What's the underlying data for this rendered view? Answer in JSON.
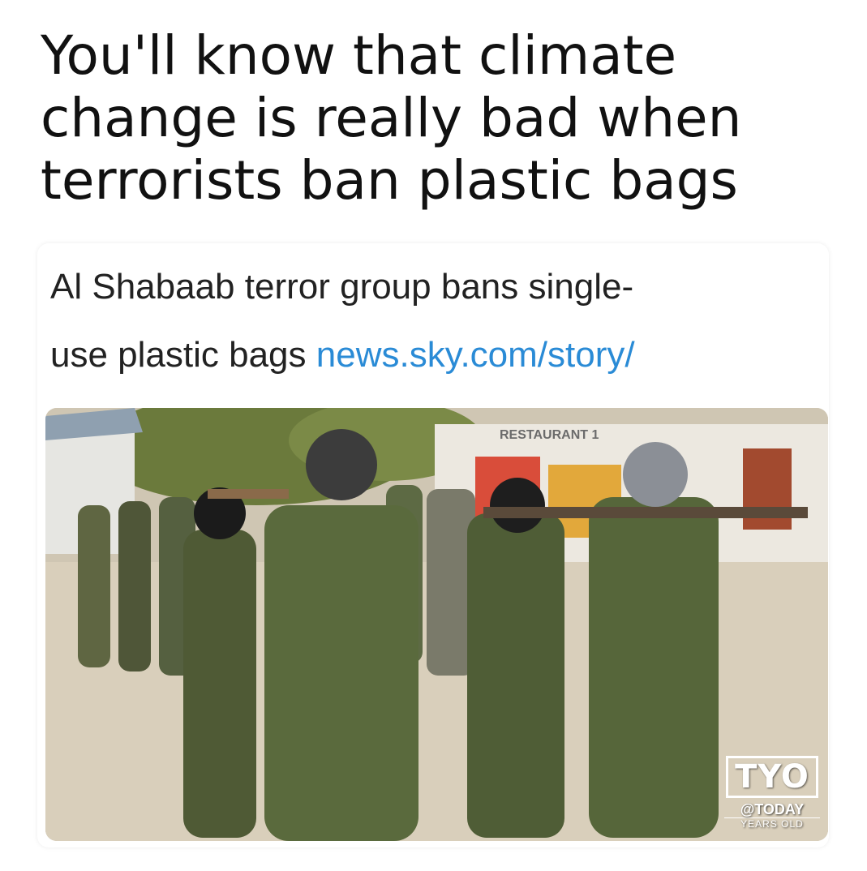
{
  "meme": {
    "caption_lines": [
      "You'll know that climate",
      "change is really bad when",
      "terrorists ban plastic bags"
    ]
  },
  "news_card": {
    "headline_line1": "Al Shabaab terror group bans single-",
    "headline_line2_text": "use plastic bags",
    "headline_link": "news.sky.com/story/",
    "link_color": "#2a8bd6"
  },
  "photo": {
    "sign_text": "RESTAURANT 1",
    "watermark": {
      "logo": "TYO",
      "handle": "@TODAY",
      "subtitle": "YEARS OLD"
    }
  }
}
